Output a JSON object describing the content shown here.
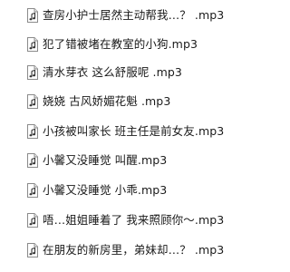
{
  "files": [
    {
      "name": "查房小护士居然主动帮我…？ .mp3",
      "icon": "audio-file-icon"
    },
    {
      "name": "犯了错被堵在教室的小狗.mp3",
      "icon": "audio-file-icon"
    },
    {
      "name": "清水芽衣  这么舒服呢 .mp3",
      "icon": "audio-file-icon"
    },
    {
      "name": "娆娆  古风娇媚花魁 .mp3",
      "icon": "audio-file-icon"
    },
    {
      "name": "小孩被叫家长 班主任是前女友.mp3",
      "icon": "audio-file-icon"
    },
    {
      "name": "小馨又没睡觉 叫醒.mp3",
      "icon": "audio-file-icon"
    },
    {
      "name": "小馨又没睡觉 小乖.mp3",
      "icon": "audio-file-icon"
    },
    {
      "name": "唔…姐姐睡着了 我来照顾你～.mp3",
      "icon": "audio-file-icon"
    },
    {
      "name": "在朋友的新房里，弟妹却…？ .mp3",
      "icon": "audio-file-icon"
    }
  ]
}
